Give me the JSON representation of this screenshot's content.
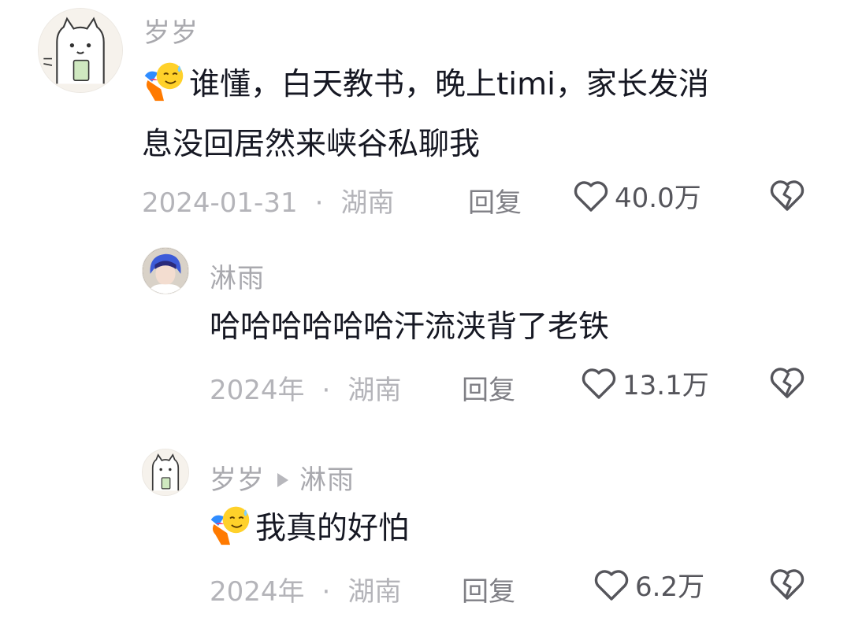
{
  "comments": [
    {
      "username": "岁岁",
      "text_line1": "谁懂，白天教书，晚上timi，家长发消",
      "text_line2": "息没回居然来峡谷私聊我",
      "date": "2024-01-31",
      "separator": "·",
      "location": "湖南",
      "reply_label": "回复",
      "likes": "40.0万",
      "emoji_icon": "sweat-smile-bow-emoji"
    },
    {
      "username": "淋雨",
      "text": "哈哈哈哈哈哈汗流浃背了老铁",
      "date": "2024年",
      "separator": "·",
      "location": "湖南",
      "reply_label": "回复",
      "likes": "13.1万"
    },
    {
      "username": "岁岁",
      "reply_to": "淋雨",
      "text": "我真的好怕",
      "date": "2024年",
      "separator": "·",
      "location": "湖南",
      "reply_label": "回复",
      "likes": "6.2万",
      "emoji_icon": "sweat-smile-bow-emoji"
    }
  ],
  "icons": {
    "like": "heart-outline-icon",
    "dislike": "broken-heart-icon",
    "reply_arrow": "play-arrow-icon"
  },
  "colors": {
    "text": "#161823",
    "muted": "#b4b4b9",
    "username": "#a9a9ae"
  }
}
